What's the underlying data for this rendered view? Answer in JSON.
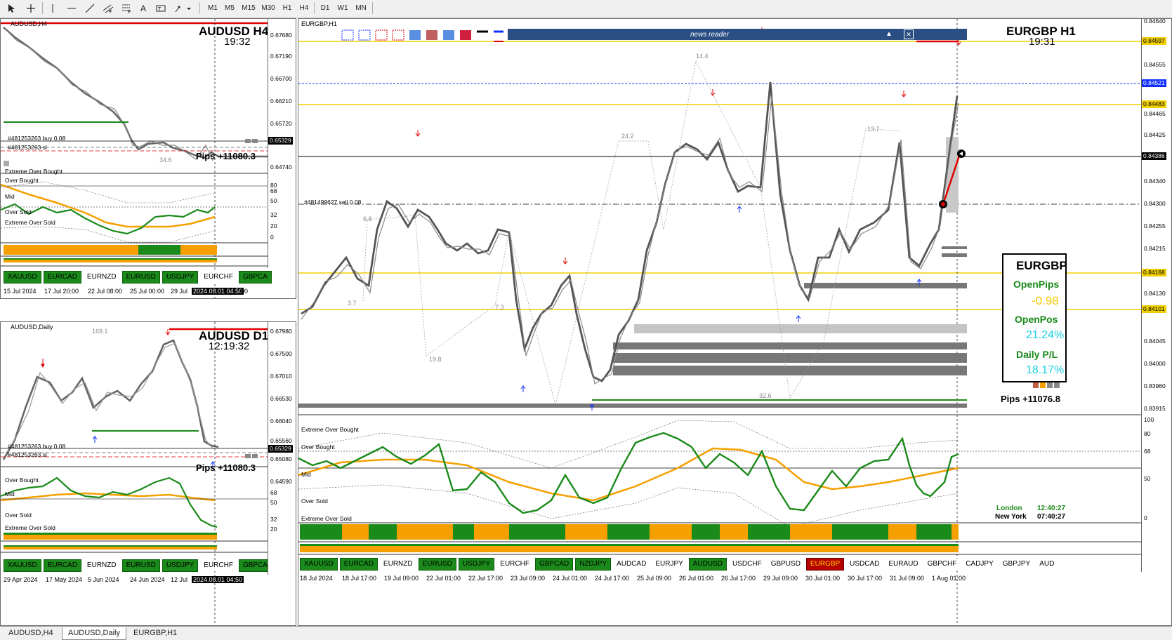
{
  "toolbar": {
    "timeframes": [
      "M1",
      "M5",
      "M15",
      "M30",
      "H1",
      "H4",
      "D1",
      "W1",
      "MN"
    ]
  },
  "charts": {
    "audusd_h4": {
      "title_small": "AUDUSD,H4",
      "symbol_label": "AUDUSD  H4",
      "countdown": "19:32",
      "prices": [
        "0.67680",
        "0.67190",
        "0.66700",
        "0.66210",
        "0.65720",
        "0.65329",
        "0.64740"
      ],
      "current_price": "0.65329",
      "order_label": "#481253263 buy 0.08",
      "sl_label": "#481253263 sl",
      "pips": "Pips +11080.3",
      "distance_label": "34.6",
      "osc_labels": [
        "Extreme Over Bought",
        "Over Bought",
        "Mid",
        "Over Sold",
        "Extreme Over Sold"
      ],
      "osc_scale": [
        "80",
        "68",
        "50",
        "32",
        "20",
        "0"
      ],
      "time_labels": [
        "15 Jul 2024",
        "17 Jul 20:00",
        "22 Jul 08:00",
        "25 Jul 00:00",
        "29 Jul",
        "2024.08.01 04:50",
        "00"
      ],
      "symbols": [
        "XAUUSD",
        "EURCAD",
        "EURNZD",
        "EURUSD",
        "USDJPY",
        "EURCHF",
        "GBPCA"
      ]
    },
    "audusd_d1": {
      "title_small": "AUDUSD,Daily",
      "symbol_label": "AUDUSD  D1",
      "countdown": "12:19:32",
      "prices": [
        "0.67980",
        "0.67500",
        "0.67010",
        "0.66530",
        "0.66040",
        "0.65560",
        "0.65329",
        "0.65080",
        "0.64590"
      ],
      "current_price": "0.65329",
      "order_label": "#481253263 buy 0.08",
      "sl_label": "#481253263 sl",
      "pips": "Pips +11080.3",
      "distance_label": "169.1",
      "osc_labels": [
        "Over Bought",
        "Mid",
        "Over Sold",
        "Extreme Over Sold"
      ],
      "osc_scale": [
        "68",
        "50",
        "32",
        "20"
      ],
      "time_labels": [
        "29 Apr 2024",
        "17 May 2024",
        "5 Jun 2024",
        "24 Jun 2024",
        "12 Jul",
        "2024.08.01 04:50"
      ],
      "symbols": [
        "XAUUSD",
        "EURCAD",
        "EURNZD",
        "EURUSD",
        "USDJPY",
        "EURCHF",
        "GBPCA"
      ]
    },
    "eurgbp_h1": {
      "title_small": "EURGBP,H1",
      "symbol_label": "EURGBP  H1",
      "countdown": "19:31",
      "news_reader": "news reader",
      "prices": [
        "0.84640",
        "0.84597",
        "0.84555",
        "0.84521",
        "0.84483",
        "0.84465",
        "0.84425",
        "0.84386",
        "0.84340",
        "0.84300",
        "0.84255",
        "0.84215",
        "0.84168",
        "0.84130",
        "0.84101",
        "0.84045",
        "0.84000",
        "0.83960",
        "0.83915"
      ],
      "current_price": "0.84386",
      "order_label": "#481499627 sell 0.08",
      "distance_labels": [
        "14.4",
        "24.2",
        "13.7",
        "6.8",
        "3.7",
        "7.3",
        "19.8",
        "32.6"
      ],
      "panel": {
        "symbol": "EURGBP",
        "open_pips_label": "OpenPips",
        "open_pips_value": "-0.98",
        "open_pos_label": "OpenPos",
        "open_pos_value": "21.24%",
        "daily_pl_label": "Daily P/L",
        "daily_pl_value": "18.17%"
      },
      "pips": "Pips +11076.8",
      "osc_labels": [
        "Extreme Over Bought",
        "Over Bought",
        "Mid",
        "Over Sold",
        "Extreme Over Sold"
      ],
      "osc_scale": [
        "100",
        "80",
        "68",
        "50",
        "0"
      ],
      "sessions": {
        "london_label": "London",
        "london_time": "12:40:27",
        "ny_label": "New York",
        "ny_time": "07:40:27"
      },
      "time_labels": [
        "18 Jul 2024",
        "18 Jul 17:00",
        "19 Jul 09:00",
        "22 Jul 01:00",
        "22 Jul 17:00",
        "23 Jul 09:00",
        "24 Jul 01:00",
        "24 Jul 17:00",
        "25 Jul 09:00",
        "26 Jul 01:00",
        "26 Jul 17:00",
        "29 Jul 09:00",
        "30 Jul 01:00",
        "30 Jul 17:00",
        "31 Jul 09:00",
        "1 Aug 01:00"
      ],
      "symbols": [
        "XAUUSD",
        "EURCAD",
        "EURNZD",
        "EURUSD",
        "USDJPY",
        "EURCHF",
        "GBPCAD",
        "NZDJPY",
        "AUDCAD",
        "EURJPY",
        "AUDUSD",
        "USDCHF",
        "GBPUSD",
        "EURGBP",
        "USDCAD",
        "EURAUD",
        "GBPCHF",
        "CADJPY",
        "GBPJPY",
        "AUD"
      ]
    }
  },
  "tabs": [
    "AUDUSD,H4",
    "AUDUSD,Daily",
    "EURGBP,H1"
  ],
  "colors": {
    "green": "#1a8a1a",
    "orange": "#f5a000",
    "red": "#e00000",
    "blue": "#1030ff",
    "gold": "#f0d000"
  }
}
